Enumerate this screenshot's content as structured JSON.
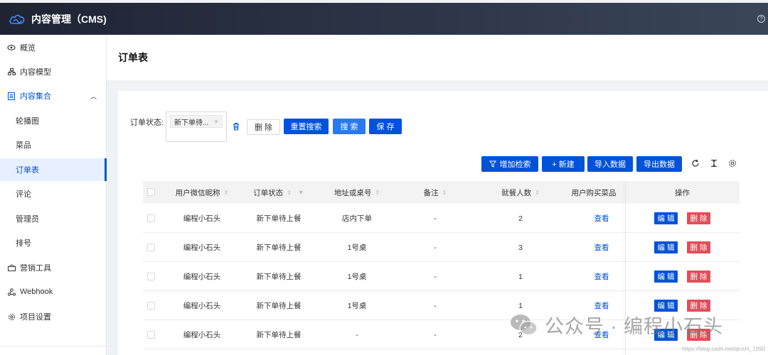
{
  "app": {
    "title": "内容管理（CMS)"
  },
  "sidebar": {
    "items": [
      {
        "label": "概览",
        "icon": "eye-icon"
      },
      {
        "label": "内容模型",
        "icon": "model-icon"
      },
      {
        "label": "内容集合",
        "icon": "list-icon"
      },
      {
        "label": "轮播图"
      },
      {
        "label": "菜品"
      },
      {
        "label": "订单表"
      },
      {
        "label": "评论"
      },
      {
        "label": "管理员"
      },
      {
        "label": "排号"
      },
      {
        "label": "营销工具",
        "icon": "shop-icon"
      },
      {
        "label": "Webhook",
        "icon": "webhook-icon"
      },
      {
        "label": "项目设置",
        "icon": "gear-icon"
      }
    ],
    "active": "订单表"
  },
  "page": {
    "title": "订单表"
  },
  "filter": {
    "label": "订单状态:",
    "tag": "新下单待...",
    "tag_close": "×",
    "delete": "删 除",
    "reset": "重置搜索",
    "search": "搜 索",
    "save": "保 存"
  },
  "toolbar": {
    "add_filter": "增加检索",
    "new": "+ 新建",
    "import": "导入数据",
    "export": "导出数据"
  },
  "table": {
    "headers": {
      "nickname": "用户微信昵称",
      "status": "订单状态",
      "address": "地址或桌号",
      "remark": "备注",
      "diners": "就餐人数",
      "dishes": "用户购买菜品",
      "ops": "操作"
    },
    "rows": [
      {
        "nickname": "编程小石头",
        "status": "新下单待上餐",
        "address": "店内下单",
        "remark": "-",
        "diners": "2",
        "dishes": "查看"
      },
      {
        "nickname": "编程小石头",
        "status": "新下单待上餐",
        "address": "1号桌",
        "remark": "-",
        "diners": "3",
        "dishes": "查看"
      },
      {
        "nickname": "编程小石头",
        "status": "新下单待上餐",
        "address": "1号桌",
        "remark": "-",
        "diners": "1",
        "dishes": "查看"
      },
      {
        "nickname": "编程小石头",
        "status": "新下单待上餐",
        "address": "1号桌",
        "remark": "-",
        "diners": "1",
        "dishes": "查看"
      },
      {
        "nickname": "编程小石头",
        "status": "新下单待上餐",
        "address": "-",
        "remark": "-",
        "diners": "2",
        "dishes": "查看"
      }
    ],
    "edit_label": "编 辑",
    "delete_label": "删 除"
  },
  "watermark": {
    "text": "公众号 · 编程小石头",
    "url": "https://blog.csdn.net/qiushi_1990"
  },
  "colors": {
    "brand": "#0052d9",
    "danger": "#e34d59",
    "header_dark": "#1f2433"
  }
}
